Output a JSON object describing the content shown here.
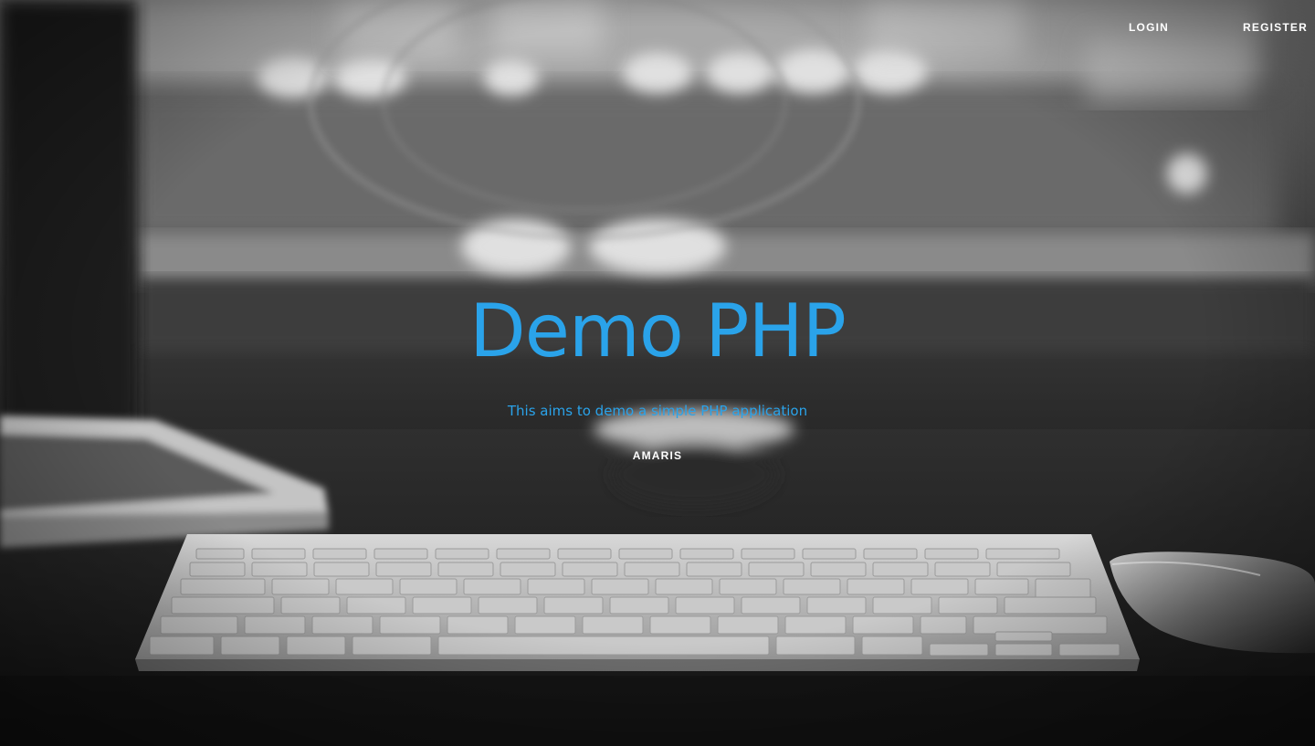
{
  "nav": {
    "login_label": "LOGIN",
    "register_label": "REGISTER"
  },
  "hero": {
    "title": "Demo PHP",
    "subtitle": "This aims to demo a simple PHP application",
    "author": "AMARIS"
  },
  "colors": {
    "accent": "#2aa3ea",
    "nav_text": "#ffffff"
  },
  "background": {
    "description_icon": "desk-keyboard-photo"
  }
}
